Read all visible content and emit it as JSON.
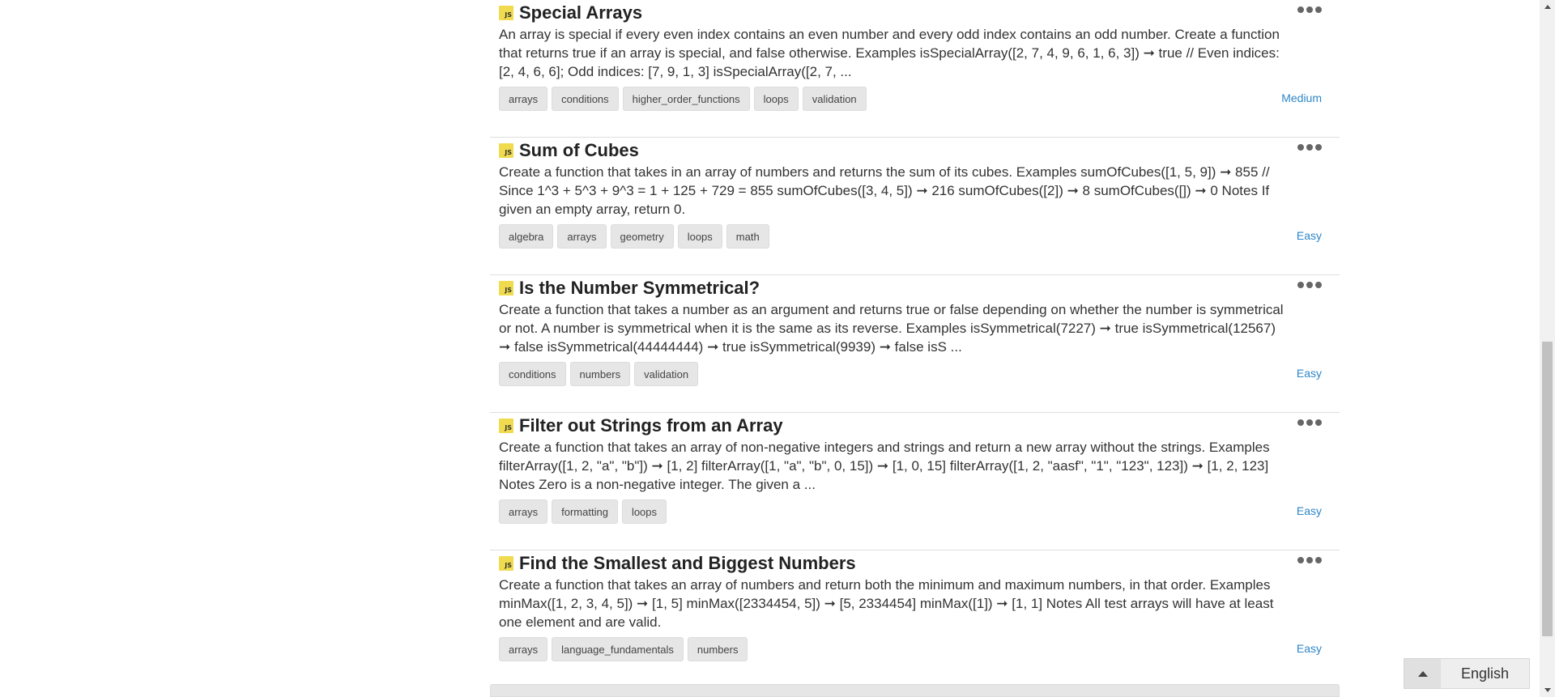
{
  "challenges": [
    {
      "badge": "JS",
      "title": "Special Arrays",
      "description": "An array is special if every even index contains an even number and every odd index contains an odd number. Create a function that returns true if an array is special, and false otherwise. Examples isSpecialArray([2, 7, 4, 9, 6, 1, 6, 3]) ➞ true // Even indices: [2, 4, 6, 6]; Odd indices: [7, 9, 1, 3] isSpecialArray([2, 7, ...",
      "tags": [
        "arrays",
        "conditions",
        "higher_order_functions",
        "loops",
        "validation"
      ],
      "difficulty": "Medium"
    },
    {
      "badge": "JS",
      "title": "Sum of Cubes",
      "description": "Create a function that takes in an array of numbers and returns the sum of its cubes. Examples sumOfCubes([1, 5, 9]) ➞ 855 // Since 1^3 + 5^3 + 9^3 = 1 + 125 + 729 = 855 sumOfCubes([3, 4, 5]) ➞ 216 sumOfCubes([2]) ➞ 8 sumOfCubes([]) ➞ 0 Notes If given an empty array, return 0.",
      "tags": [
        "algebra",
        "arrays",
        "geometry",
        "loops",
        "math"
      ],
      "difficulty": "Easy"
    },
    {
      "badge": "JS",
      "title": "Is the Number Symmetrical?",
      "description": "Create a function that takes a number as an argument and returns true or false depending on whether the number is symmetrical or not. A number is symmetrical when it is the same as its reverse. Examples isSymmetrical(7227) ➞ true isSymmetrical(12567) ➞ false isSymmetrical(44444444) ➞ true isSymmetrical(9939) ➞ false isS ...",
      "tags": [
        "conditions",
        "numbers",
        "validation"
      ],
      "difficulty": "Easy"
    },
    {
      "badge": "JS",
      "title": "Filter out Strings from an Array",
      "description": "Create a function that takes an array of non-negative integers and strings and return a new array without the strings. Examples filterArray([1, 2, \"a\", \"b\"]) ➞ [1, 2] filterArray([1, \"a\", \"b\", 0, 15]) ➞ [1, 0, 15] filterArray([1, 2, \"aasf\", \"1\", \"123\", 123]) ➞ [1, 2, 123] Notes Zero is a non-negative integer. The given a ...",
      "tags": [
        "arrays",
        "formatting",
        "loops"
      ],
      "difficulty": "Easy"
    },
    {
      "badge": "JS",
      "title": "Find the Smallest and Biggest Numbers",
      "description": "Create a function that takes an array of numbers and return both the minimum and maximum numbers, in that order. Examples minMax([1, 2, 3, 4, 5]) ➞ [1, 5] minMax([2334454, 5]) ➞ [5, 2334454] minMax([1]) ➞ [1, 1] Notes All test arrays will have at least one element and are valid.",
      "tags": [
        "arrays",
        "language_fundamentals",
        "numbers"
      ],
      "difficulty": "Easy"
    }
  ],
  "language_selector": {
    "label": "English",
    "icon": "caret-up-icon"
  },
  "colors": {
    "js_badge": "#f0db4f",
    "difficulty_link": "#2e86c8",
    "tag_bg": "#e6e6e6"
  }
}
